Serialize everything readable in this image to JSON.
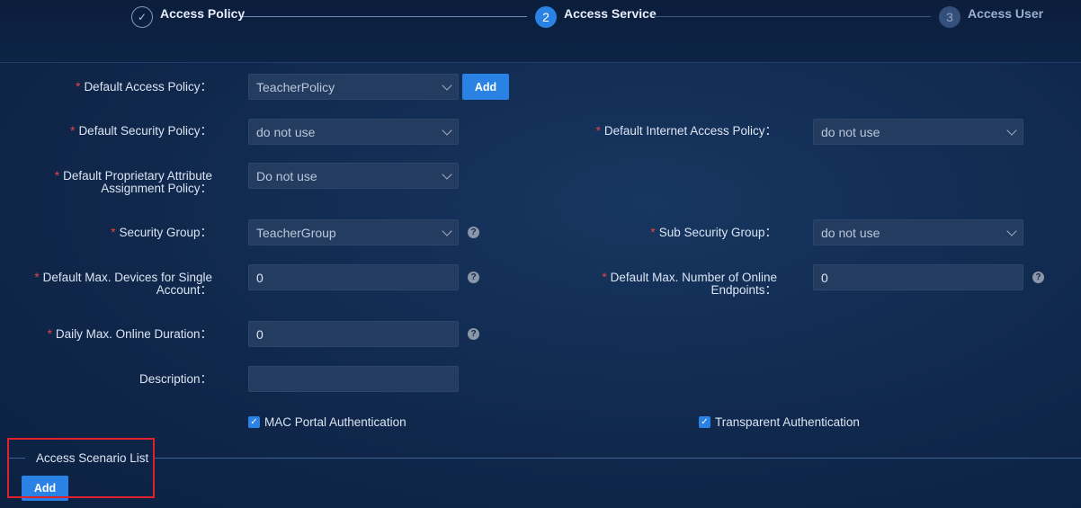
{
  "stepper": {
    "steps": [
      {
        "label": "Access Policy",
        "marker": "✓",
        "state": "done"
      },
      {
        "label": "Access Service",
        "marker": "2",
        "state": "active"
      },
      {
        "label": "Access User",
        "marker": "3",
        "state": "pending"
      }
    ]
  },
  "form": {
    "default_access_policy": {
      "label": "Default Access Policy：",
      "value": "TeacherPolicy",
      "add_label": "Add"
    },
    "default_security_policy": {
      "label": "Default Security Policy：",
      "value": "do not use"
    },
    "default_internet_access_policy": {
      "label": "Default Internet Access Policy：",
      "value": "do not use"
    },
    "default_proprietary_attribute": {
      "label_line1": "Default Proprietary Attribute",
      "label_line2": "Assignment Policy：",
      "value": "Do not use"
    },
    "security_group": {
      "label": "Security Group：",
      "value": "TeacherGroup"
    },
    "sub_security_group": {
      "label": "Sub Security Group：",
      "value": "do not use"
    },
    "max_devices": {
      "label_line1": "Default Max. Devices for Single",
      "label_line2": "Account：",
      "value": "0"
    },
    "max_online_endpoints": {
      "label_line1": "Default Max. Number of Online",
      "label_line2": "Endpoints：",
      "value": "0"
    },
    "daily_max_online": {
      "label": "Daily Max. Online Duration：",
      "value": "0"
    },
    "description": {
      "label": "Description：",
      "value": ""
    },
    "mac_portal": {
      "label": "MAC Portal Authentication",
      "checked": true
    },
    "transparent": {
      "label": "Transparent Authentication",
      "checked": true
    }
  },
  "scenario": {
    "title": "Access Scenario List",
    "add_label": "Add"
  },
  "icons": {
    "help": "?",
    "check": "✓"
  },
  "colors": {
    "accent": "#2a82e4",
    "required": "#e64545",
    "highlight": "#e0202a"
  }
}
